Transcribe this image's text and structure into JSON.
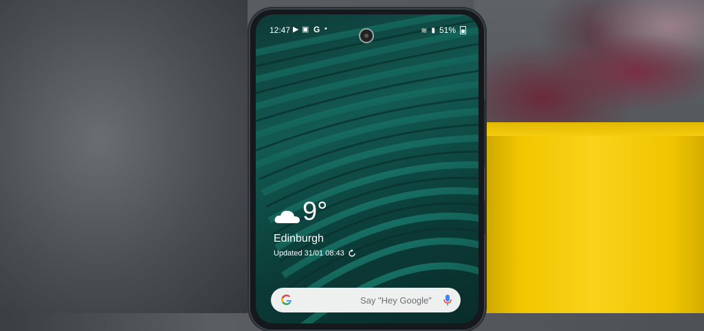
{
  "status_bar": {
    "time": "12:47",
    "indicator_g": "G",
    "battery_percent": "51%"
  },
  "weather_widget": {
    "temperature": "9°",
    "city": "Edinburgh",
    "updated": "Updated 31/01 08:43"
  },
  "search_bar": {
    "placeholder": "Say \"Hey Google\""
  },
  "icons": [
    "play-icon",
    "message-icon",
    "google-g-icon",
    "wifi-icon",
    "signal-icon",
    "battery-icon",
    "cloud-icon",
    "refresh-icon",
    "google-logo-icon",
    "microphone-icon"
  ]
}
